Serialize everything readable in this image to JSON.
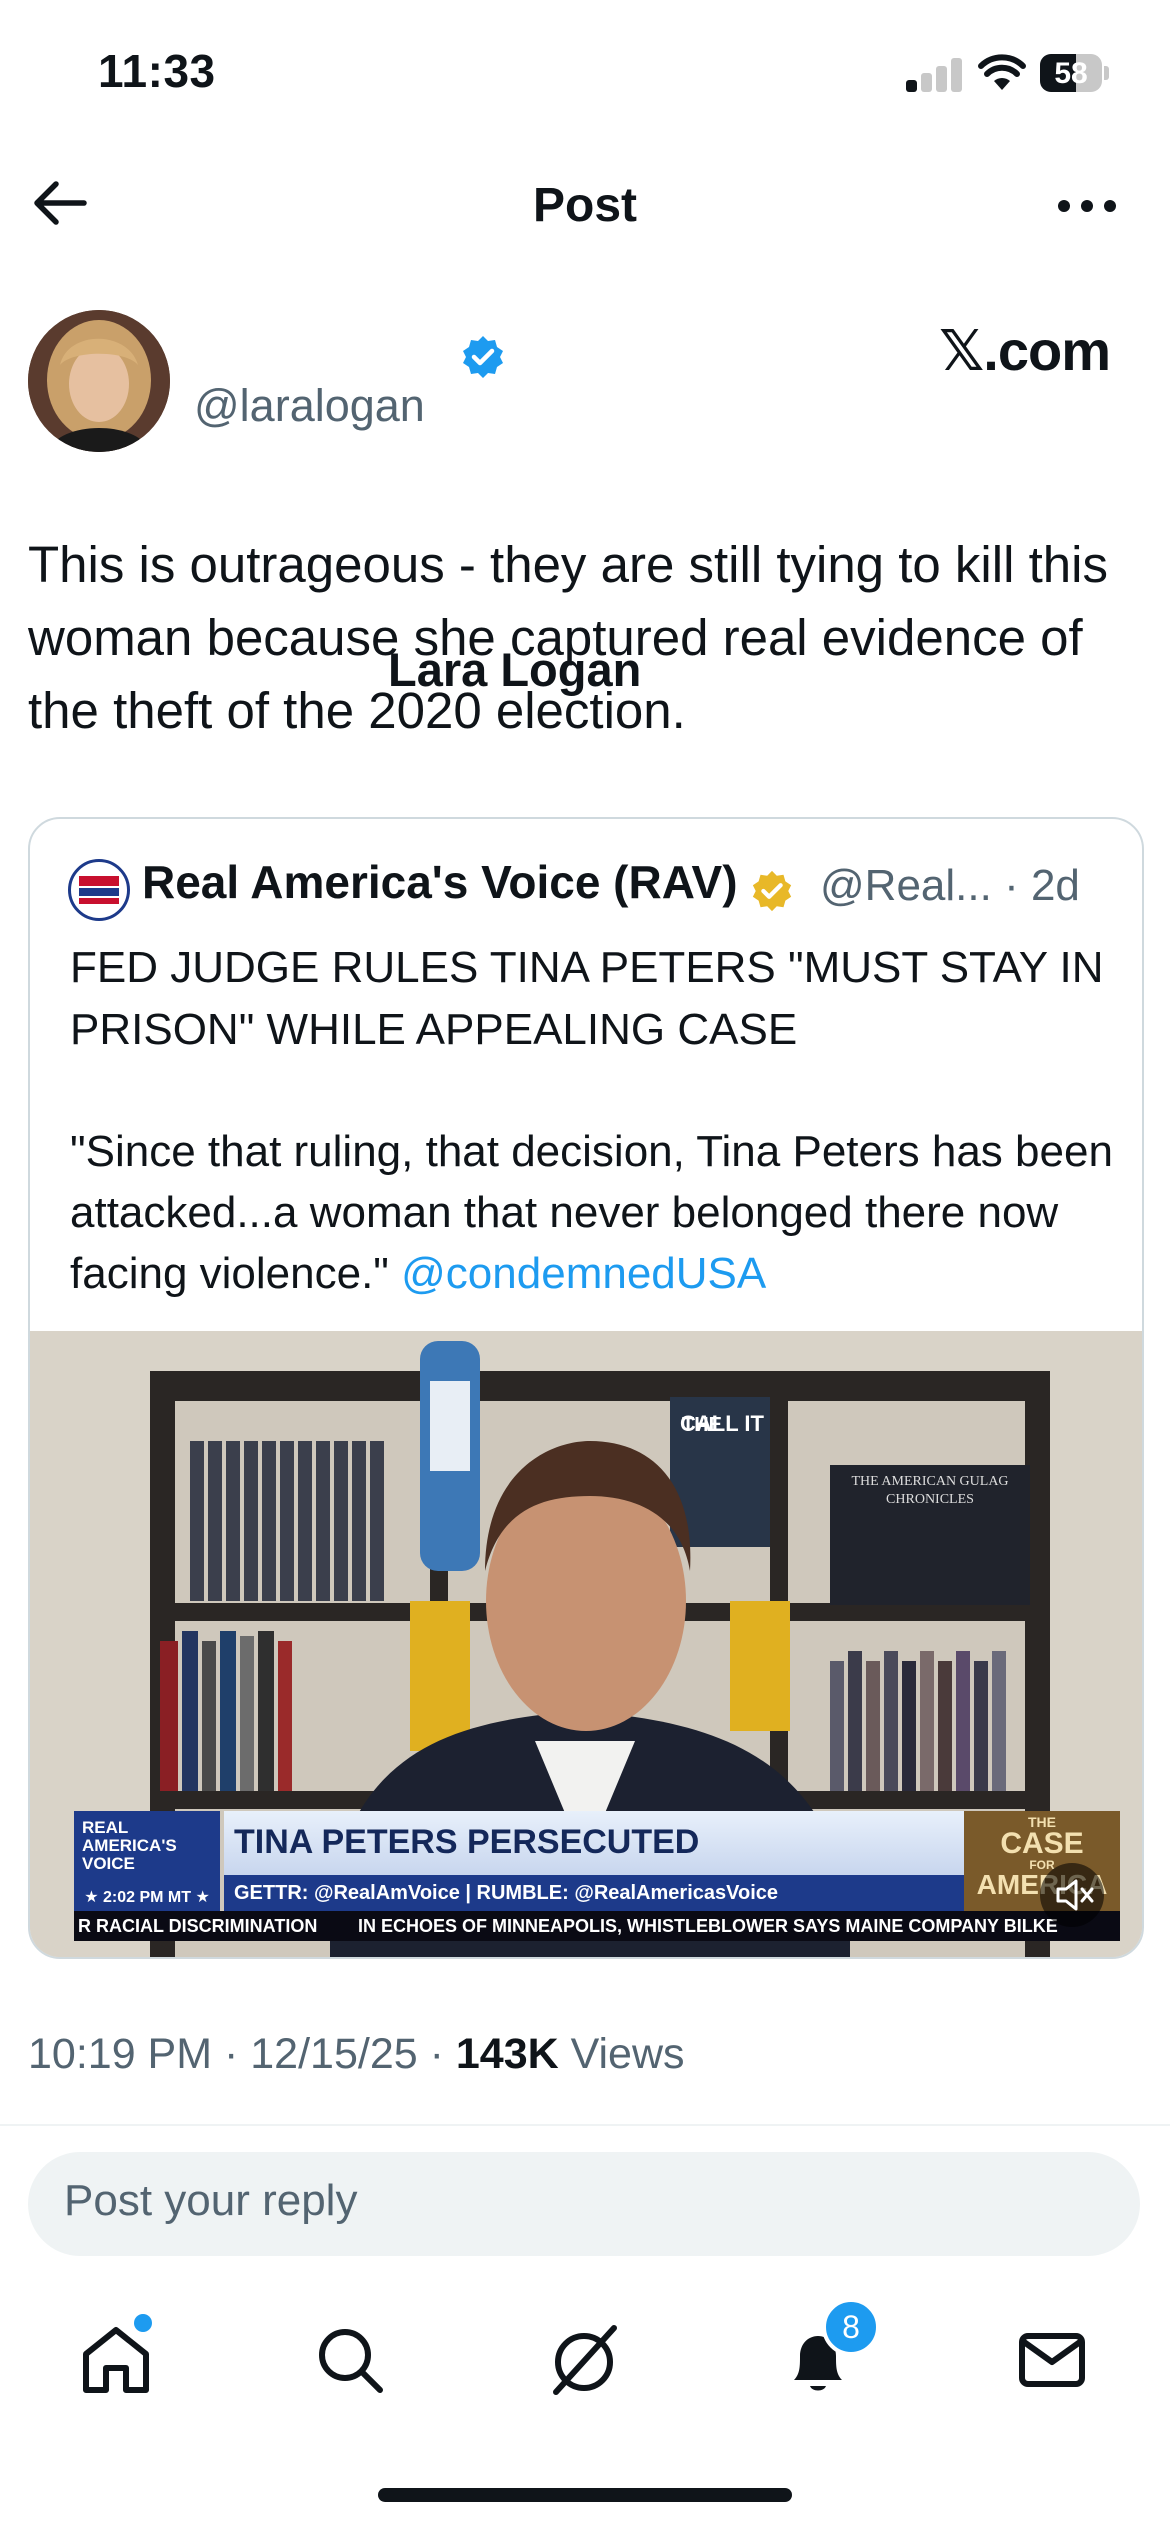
{
  "status_bar": {
    "time": "11:33",
    "battery": "58"
  },
  "header": {
    "title": "Post"
  },
  "author": {
    "name": "Lara Logan",
    "handle": "@laralogan",
    "brand": "𝕏.com"
  },
  "post": {
    "text": "This is outrageous - they are still tying to kill this woman because she captured real evidence of the theft of the 2020 election."
  },
  "quote": {
    "name": "Real America's Voice (RAV)",
    "handle": "@Real...",
    "time": "· 2d",
    "headline": "FED JUDGE RULES TINA PETERS \"MUST STAY IN PRISON\" WHILE APPEALING CASE",
    "body": "\"Since that ruling, that decision, Tina Peters has been attacked...a woman that never belonged there now facing violence.\" ",
    "mention": "@condemnedUSA",
    "video": {
      "books_banner": "THE AMERICAN GULAG CHRONICLES",
      "book_small": "CALL IT",
      "lower_third": {
        "logo": "REAL AMERICA'S VOICE",
        "time": "★ 2:02 PM MT ★",
        "title": "TINA PETERS PERSECUTED",
        "subtitle": "GETTR: @RealAmVoice | RUMBLE: @RealAmericasVoice",
        "show_top": "THE",
        "show_main": "CASE",
        "show_for": "FOR",
        "show_bottom": "AMERICA",
        "ticker_left": "R RACIAL DISCRIMINATION",
        "ticker_right": "IN ECHOES OF MINNEAPOLIS, WHISTLEBLOWER SAYS MAINE COMPANY BILKE"
      }
    }
  },
  "meta": {
    "time": "10:19 PM · 12/15/25 · ",
    "views_count": "143K",
    "views_label": " Views"
  },
  "reply": {
    "placeholder": "Post your reply"
  },
  "tabbar": {
    "notification_count": "8"
  },
  "colors": {
    "accent": "#1d9bf0",
    "verified_blue": "#1d9bf0",
    "verified_gold": "#e8b828",
    "text": "#0f1419",
    "muted": "#536471"
  }
}
